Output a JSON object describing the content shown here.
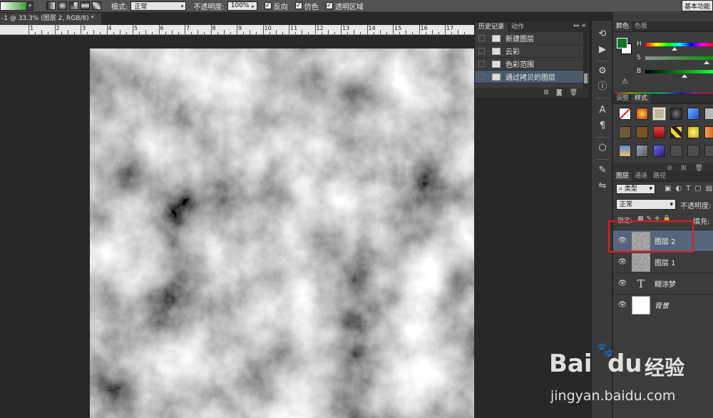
{
  "options_bar": {
    "mode_label": "模式:",
    "mode_value": "正常",
    "opacity_label": "不透明度:",
    "opacity_value": "100%",
    "reverse_label": "反向",
    "dither_label": "仿色",
    "transparency_label": "透明区域",
    "workspace_button": "基本功能"
  },
  "document": {
    "tab_title": "-1 @ 33.3% (图层 2, RGB/8) *",
    "ruler_numbers": [
      "1",
      "2",
      "3",
      "4",
      "5",
      "6",
      "7",
      "8",
      "9",
      "10",
      "11",
      "12",
      "13",
      "14",
      "15",
      "16",
      "17"
    ]
  },
  "history_panel": {
    "tabs": [
      "历史记录",
      "动作"
    ],
    "items": [
      {
        "label": "新建图层",
        "active": false
      },
      {
        "label": "云彩",
        "active": false
      },
      {
        "label": "色彩范围",
        "active": false
      },
      {
        "label": "通过拷贝的图层",
        "active": true
      }
    ]
  },
  "color_panel": {
    "tabs": [
      "颜色",
      "色板"
    ],
    "foreground": "#107424",
    "background": "#ffffff",
    "sliders": [
      {
        "label": "H",
        "value": "116"
      },
      {
        "label": "S",
        "value": "90"
      },
      {
        "label": "B",
        "value": "56"
      }
    ]
  },
  "styles_panel": {
    "tabs": [
      "调整",
      "样式"
    ]
  },
  "layers_panel": {
    "tabs": [
      "图层",
      "通道",
      "路径"
    ],
    "filter_kind": "类型",
    "blend_mode": "正常",
    "opacity_label": "不透明度:",
    "lock_label": "锁定:",
    "fill_label": "填充:",
    "layers": [
      {
        "name": "图层 2",
        "type": "noise",
        "active": true
      },
      {
        "name": "图层 1",
        "type": "noise",
        "active": false
      },
      {
        "name": "糊涂梦",
        "type": "text",
        "active": false
      },
      {
        "name": "背景",
        "type": "white",
        "active": false
      }
    ]
  },
  "watermark": {
    "brand_latin": "Bai",
    "brand_paw": "du",
    "brand_cn": "经验",
    "url": "jingyan.baidu.com"
  }
}
